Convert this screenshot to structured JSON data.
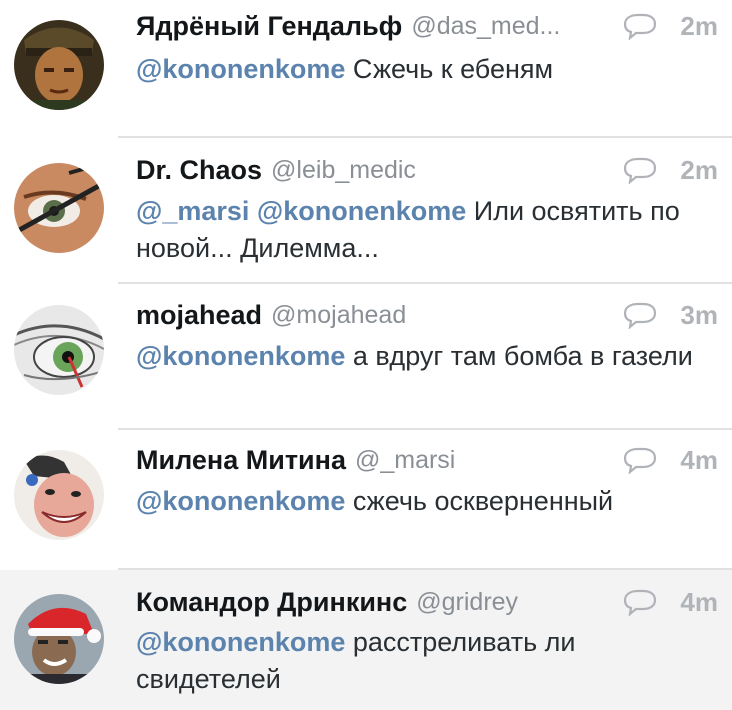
{
  "tweets": [
    {
      "name": "Ядрёный Гендальф",
      "handle": "@das_med...",
      "time": "2m",
      "mentions": [
        "@kononenkome"
      ],
      "text": "Сжечь к ебеням",
      "avatar_icon": "soldier-avatar-icon"
    },
    {
      "name": "Dr. Chaos",
      "handle": "@leib_medic",
      "time": "2m",
      "mentions": [
        "@_marsi",
        "@kononenkome"
      ],
      "text": "Или освятить по новой... Дилемма...",
      "avatar_icon": "eye-glasses-avatar-icon"
    },
    {
      "name": "mojahead",
      "handle": "@mojahead",
      "time": "3m",
      "mentions": [
        "@kononenkome"
      ],
      "text": "а вдруг там бомба в газели",
      "avatar_icon": "eye-closeup-avatar-icon"
    },
    {
      "name": "Милена Митина",
      "handle": "@_marsi",
      "time": "4m",
      "mentions": [
        "@kononenkome"
      ],
      "text": "сжечь оскверненный",
      "avatar_icon": "grinning-face-avatar-icon"
    },
    {
      "name": "Командор Дринкинс",
      "handle": "@gridrey",
      "time": "4m",
      "mentions": [
        "@kononenkome"
      ],
      "text": "расстреливать ли свидетелей",
      "avatar_icon": "santa-hat-avatar-icon"
    }
  ],
  "colors": {
    "mention": "#5b83ad",
    "name": "#14171a",
    "handle": "#8a8f95",
    "time": "#b0b3b7",
    "separator": "#e1e1e1",
    "highlight_bg": "#f3f3f3"
  },
  "icons": {
    "reply": "reply-bubble-icon"
  }
}
